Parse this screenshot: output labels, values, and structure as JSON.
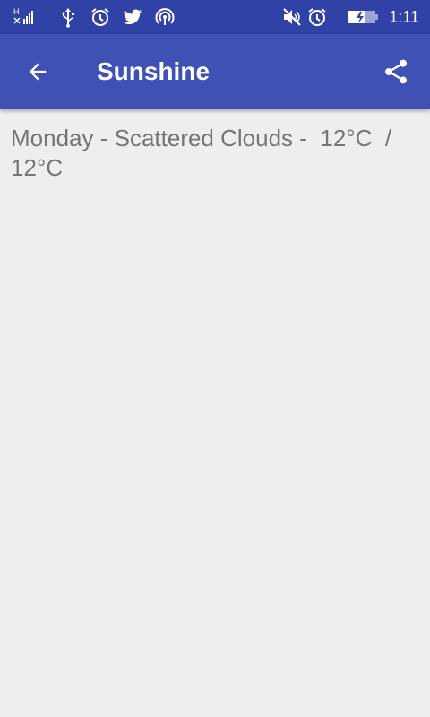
{
  "status_bar": {
    "time": "1:11",
    "signal_badge": "H",
    "icons": [
      "signal-icon",
      "usb-icon",
      "alarm-icon",
      "twitter-icon",
      "hotspot-icon",
      "mute-icon",
      "alarm-icon",
      "battery-icon"
    ]
  },
  "app_bar": {
    "title": "Sunshine",
    "back_icon": "arrow-back-icon",
    "share_icon": "share-icon"
  },
  "detail": {
    "forecast": "Monday - Scattered Clouds -  12°C  /  12°C"
  },
  "colors": {
    "status_bar": "#3042a6",
    "app_bar": "#3f51b5",
    "background": "#eeeeee",
    "text": "#757575"
  }
}
